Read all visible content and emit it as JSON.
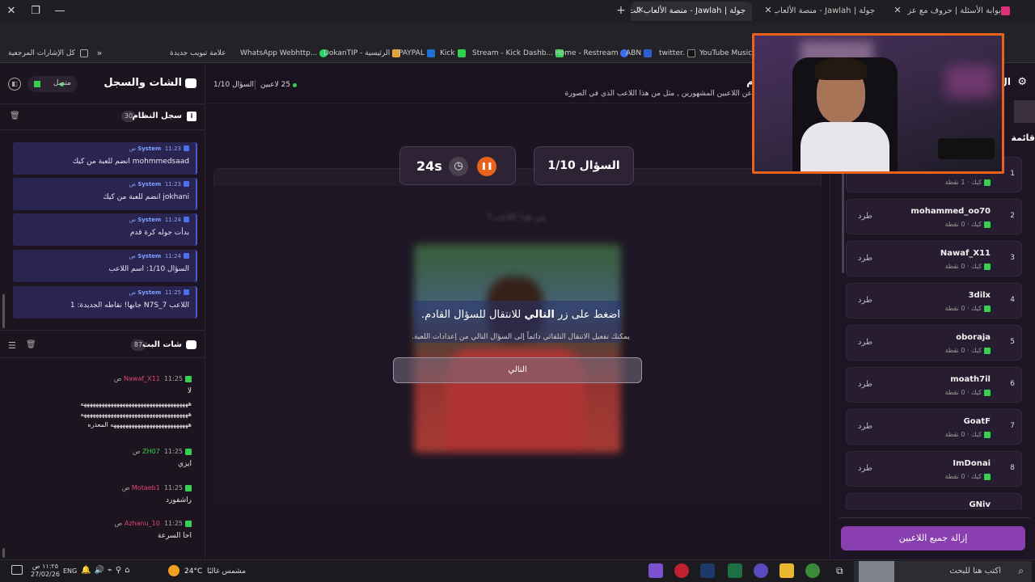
{
  "browser": {
    "tabs": [
      {
        "label": "بوابة الأسئلة | حروف مع عزيز",
        "active": false
      },
      {
        "label": "جولة | Jawlah - منصة الألعاب الت",
        "active": false
      },
      {
        "label": "جولة | Jawlah - منصة الألعاب الت",
        "active": true
      }
    ],
    "bookmarks": [
      "كل الإشارات المرجعية",
      "علامة تبويب جديدة",
      "WhatsApp Webhttp...",
      "DokanTIP - الرئيسية",
      "PAYPAL",
      "Kick",
      "Stream - Kick Dashb...",
      "Home - Restream",
      "ABN",
      "twitter.",
      "YouTube Music"
    ]
  },
  "left_panel": {
    "title": "الشات والسجل",
    "status": "متصل",
    "system_log": {
      "title": "سجل النظام",
      "count": "30",
      "messages": [
        {
          "sender": "System",
          "time": "11:23 ص",
          "text": "mohmmedsaad انضم للعبة من كيك"
        },
        {
          "sender": "System",
          "time": "11:23 ص",
          "text": "jokhani انضم للعبة من كيك"
        },
        {
          "sender": "System",
          "time": "11:24 ص",
          "text": "بدأت جوله كرة قدم"
        },
        {
          "sender": "System",
          "time": "11:24 ص",
          "text": "السؤال 1/10: اسم اللاعب"
        },
        {
          "sender": "System",
          "time": "11:25 ص",
          "text": "اللاعب N7S_7 جابها! نقاطه الجديدة: 1"
        }
      ]
    },
    "live_chat": {
      "title": "شات البث",
      "count": "87",
      "messages": [
        {
          "user": "Nawaf_X11",
          "color": "#e0407a",
          "time": "11:25 ص",
          "lines": [
            "لا",
            "ههههههههههههههههههههههههههههههههههههه",
            "ههههههههههههههههههههههههههههههههههههه",
            "ههههههههههههههههههههههههههه المعذره"
          ]
        },
        {
          "user": "ZH07",
          "color": "#35d04f",
          "time": "11:25 ص",
          "lines": [
            "ايزي"
          ]
        },
        {
          "user": "Motaeb1",
          "color": "#e0407a",
          "time": "11:25 ص",
          "lines": [
            "راشفورد"
          ]
        },
        {
          "user": "Azhanu_10",
          "color": "#e0407a",
          "time": "11:25 ص",
          "lines": [
            "احا السرعة"
          ]
        }
      ]
    }
  },
  "center": {
    "players_count": "25 لاعبين",
    "question_counter": "السؤال 1/10",
    "header_title": "م",
    "header_subtitle": "عن اللاعبين المشهورين , مثل من هذا اللاعب الذي في الصورة",
    "question_badge": "السؤال 1/10",
    "timer": "24s",
    "hidden_answer": "من هذا اللاعب؟",
    "prompt_before": "اضغط على زر ",
    "prompt_bold": "التالي",
    "prompt_after": " للانتقال للسؤال القادم.",
    "hint": "يمكنك تفعيل الانتقال التلقائي دائماً إلى السؤال التالي من إعدادات اللعبة.",
    "next_button": "التالي"
  },
  "right_panel": {
    "title": "ال",
    "list_title": "قائمة",
    "players": [
      {
        "rank": "1",
        "name": "",
        "points": "كيك · 1 نقطة",
        "kick": ""
      },
      {
        "rank": "2",
        "name": "mohammed_oo70",
        "points": "كيك · 0 نقطة",
        "kick": "طرد"
      },
      {
        "rank": "3",
        "name": "Nawaf_X11",
        "points": "كيك · 0 نقطة",
        "kick": "طرد"
      },
      {
        "rank": "4",
        "name": "3dilx",
        "points": "كيك · 0 نقطة",
        "kick": "طرد"
      },
      {
        "rank": "5",
        "name": "oboraja",
        "points": "كيك · 0 نقطة",
        "kick": "طرد"
      },
      {
        "rank": "6",
        "name": "moath7il",
        "points": "كيك · 0 نقطة",
        "kick": "طرد"
      },
      {
        "rank": "7",
        "name": "GoatF",
        "points": "كيك · 0 نقطة",
        "kick": "طرد"
      },
      {
        "rank": "8",
        "name": "ImDonai",
        "points": "كيك · 0 نقطة",
        "kick": "طرد"
      },
      {
        "rank": "",
        "name": "GNiv",
        "points": "",
        "kick": ""
      }
    ],
    "remove_all": "إزالة جميع اللاعبين"
  },
  "taskbar": {
    "search": "اكتب هنا للبحث",
    "weather_temp": "24°C",
    "weather_text": "مشمس غالبًا",
    "lang": "ENG",
    "time": "١١:٢٥ ص",
    "date": "27/02/26"
  }
}
